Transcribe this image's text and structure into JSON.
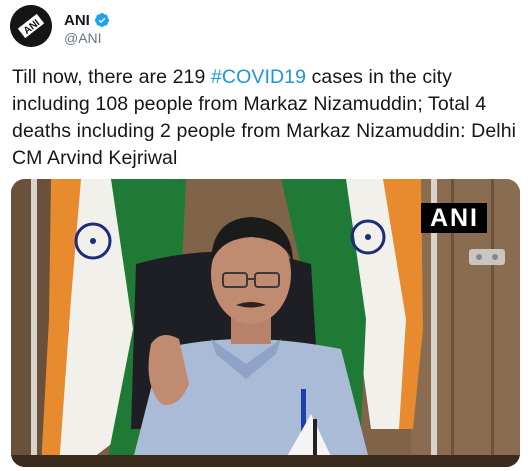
{
  "author": {
    "display_name": "ANI",
    "handle": "@ANI",
    "avatar_icon": "ani-logo-icon",
    "verified_icon": "verified-badge-icon"
  },
  "tweet": {
    "text_before": "Till now, there are 219 ",
    "hashtag": "#COVID19",
    "text_after": " cases in the city including 108 people from Markaz Nizamuddin; Total 4 deaths including 2 people from Markaz Nizamuddin: Delhi CM Arvind Kejriwal"
  },
  "media": {
    "watermark": "ANI"
  },
  "colors": {
    "link": "#1b95e0",
    "verified": "#1da1f2",
    "secondary_text": "#657786"
  }
}
